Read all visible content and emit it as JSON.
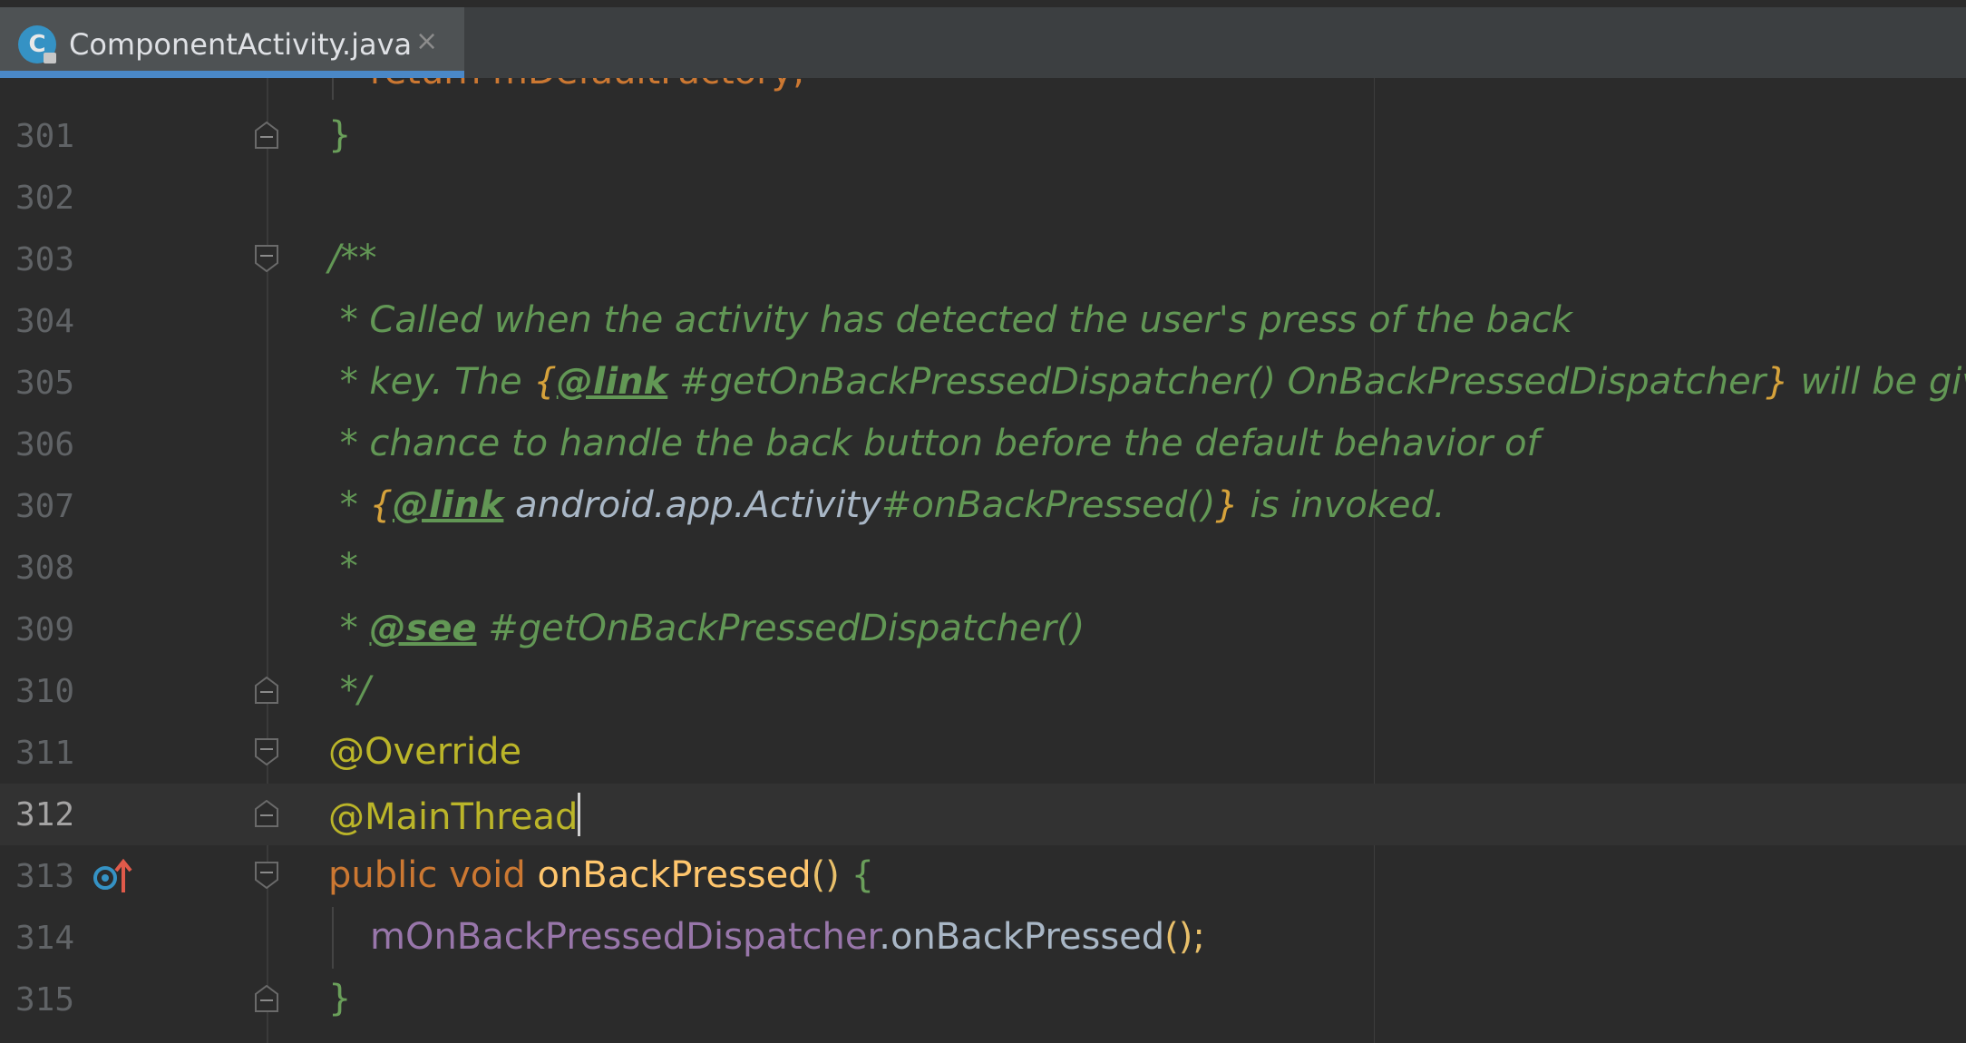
{
  "tab": {
    "icon_letter": "C",
    "title": "ComponentActivity.java",
    "close_glyph": "×"
  },
  "editor": {
    "partial_top_line": "return mDefaultFactory;",
    "lines": [
      {
        "number": "301"
      },
      {
        "number": "302"
      },
      {
        "number": "303"
      },
      {
        "number": "304"
      },
      {
        "number": "305"
      },
      {
        "number": "306"
      },
      {
        "number": "307"
      },
      {
        "number": "308"
      },
      {
        "number": "309"
      },
      {
        "number": "310"
      },
      {
        "number": "311"
      },
      {
        "number": "312"
      },
      {
        "number": "313"
      },
      {
        "number": "314"
      },
      {
        "number": "315"
      }
    ],
    "code": {
      "l301": "}",
      "l303": "/**",
      "l304": " * Called when the activity has detected the user's press of the back",
      "l305_a": " * key. The ",
      "l305_brace_open": "{",
      "l305_tag": "@link",
      "l305_b": " #getOnBackPressedDispatcher() OnBackPressedDispatcher",
      "l305_brace_close": "}",
      "l305_c": " will be given a",
      "l306": " * chance to handle the back button before the default behavior of",
      "l307_a": " * ",
      "l307_brace_open": "{",
      "l307_tag": "@link",
      "l307_ref": " android.app.Activity",
      "l307_b": "#onBackPressed()",
      "l307_brace_close": "}",
      "l307_c": " is invoked.",
      "l308": " *",
      "l309_a": " * ",
      "l309_tag": "@see",
      "l309_b": " #getOnBackPressedDispatcher()",
      "l310": " */",
      "l311": "@Override",
      "l312": "@MainThread",
      "l313_kw": "public void ",
      "l313_fn": "onBackPressed",
      "l313_paren": "()",
      "l313_brace": " {",
      "l314_field": "mOnBackPressedDispatcher",
      "l314_call": ".onBackPressed",
      "l314_paren": "();",
      "l315": "}"
    },
    "current_line": "312",
    "gutter_icons": {
      "l313": "override-method-icon"
    }
  },
  "colors": {
    "background": "#2b2b2b",
    "keyword": "#cc7832",
    "function": "#ffc66d",
    "annotation": "#bbb529",
    "doc_comment": "#629755",
    "field": "#9876aa",
    "tab_accent": "#4a88c7"
  }
}
